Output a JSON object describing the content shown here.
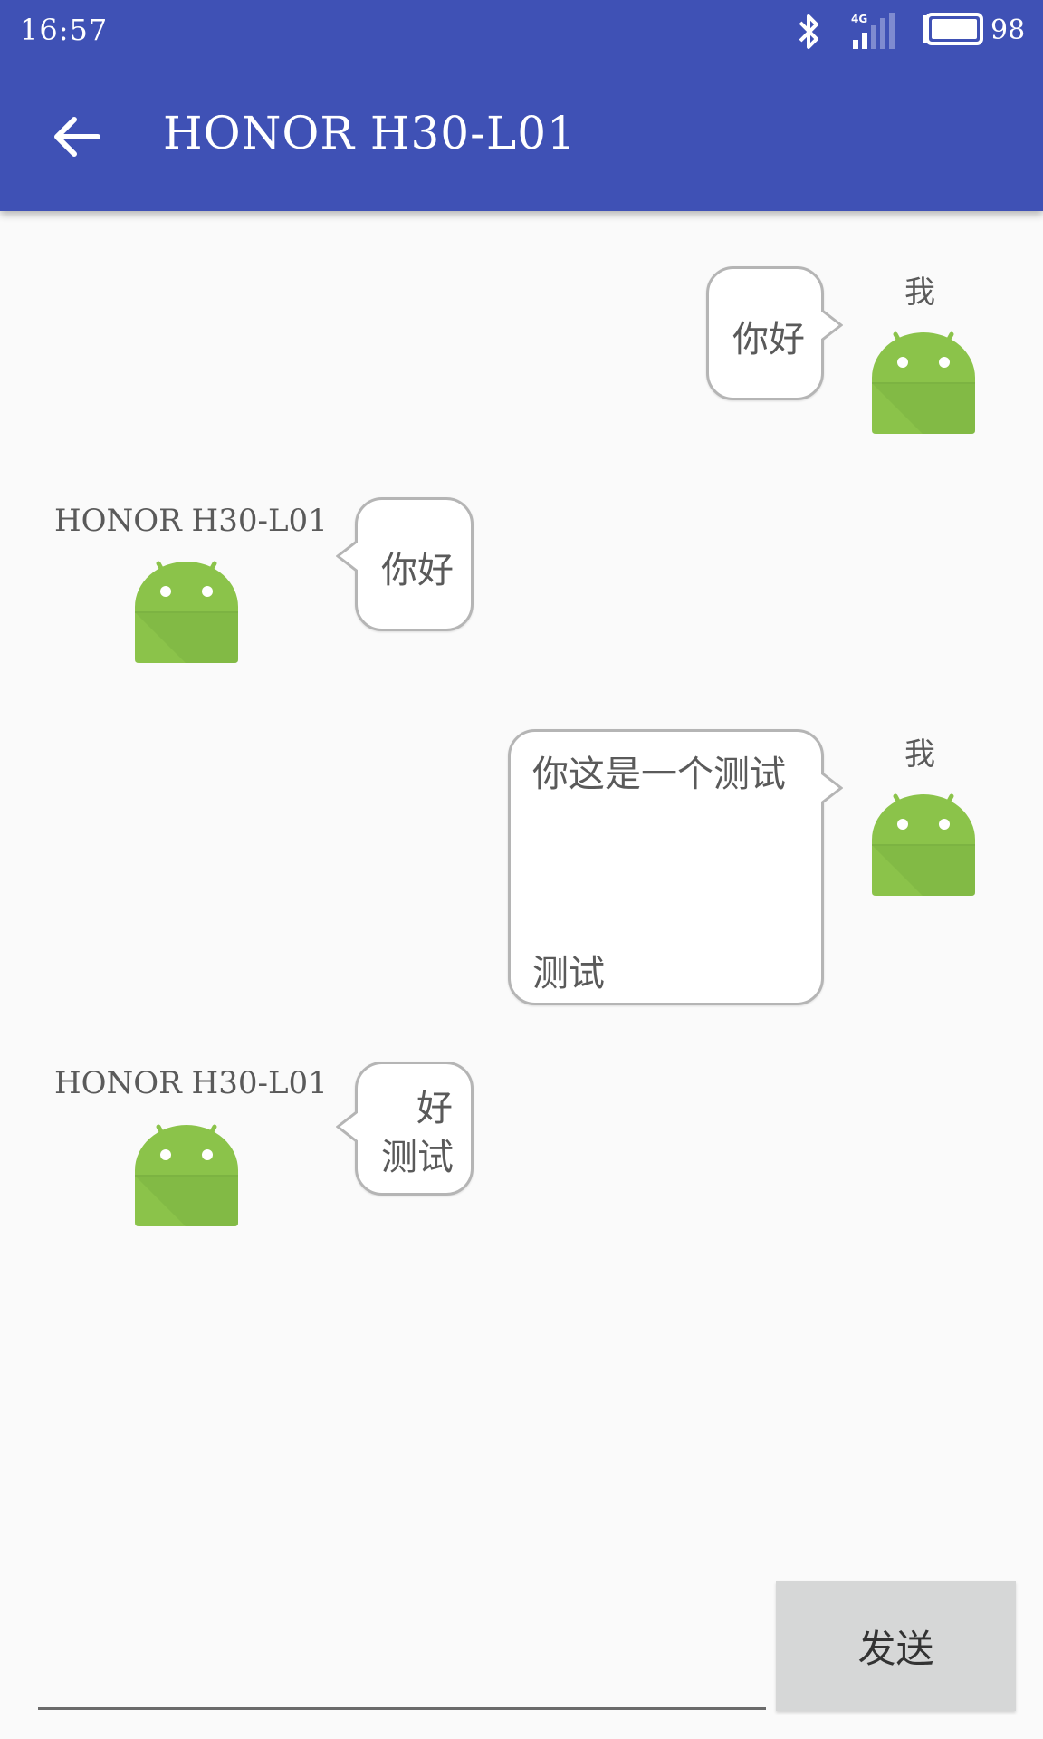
{
  "status_bar": {
    "time": "16:57",
    "network_label": "4G",
    "battery_level": "98",
    "icons": [
      "bluetooth-icon",
      "signal-icon",
      "battery-icon"
    ]
  },
  "app_bar": {
    "title": "HONOR H30-L01",
    "back_icon": "arrow-left-icon",
    "color": "#3f51b5"
  },
  "messages": [
    {
      "side": "right",
      "sender": "我",
      "line1": "你好",
      "line2": ""
    },
    {
      "side": "left",
      "sender": "HONOR H30-L01",
      "line1": "你好",
      "line2": ""
    },
    {
      "side": "right",
      "sender": "我",
      "line1": "你这是一个测试",
      "line2": "测试"
    },
    {
      "side": "left",
      "sender": "HONOR H30-L01",
      "line1": "好",
      "line2": "测试"
    }
  ],
  "composer": {
    "input_value": "",
    "send_label": "发送"
  },
  "colors": {
    "avatar_green": "#8bc34a",
    "bubble_border": "#b5b5b5"
  }
}
